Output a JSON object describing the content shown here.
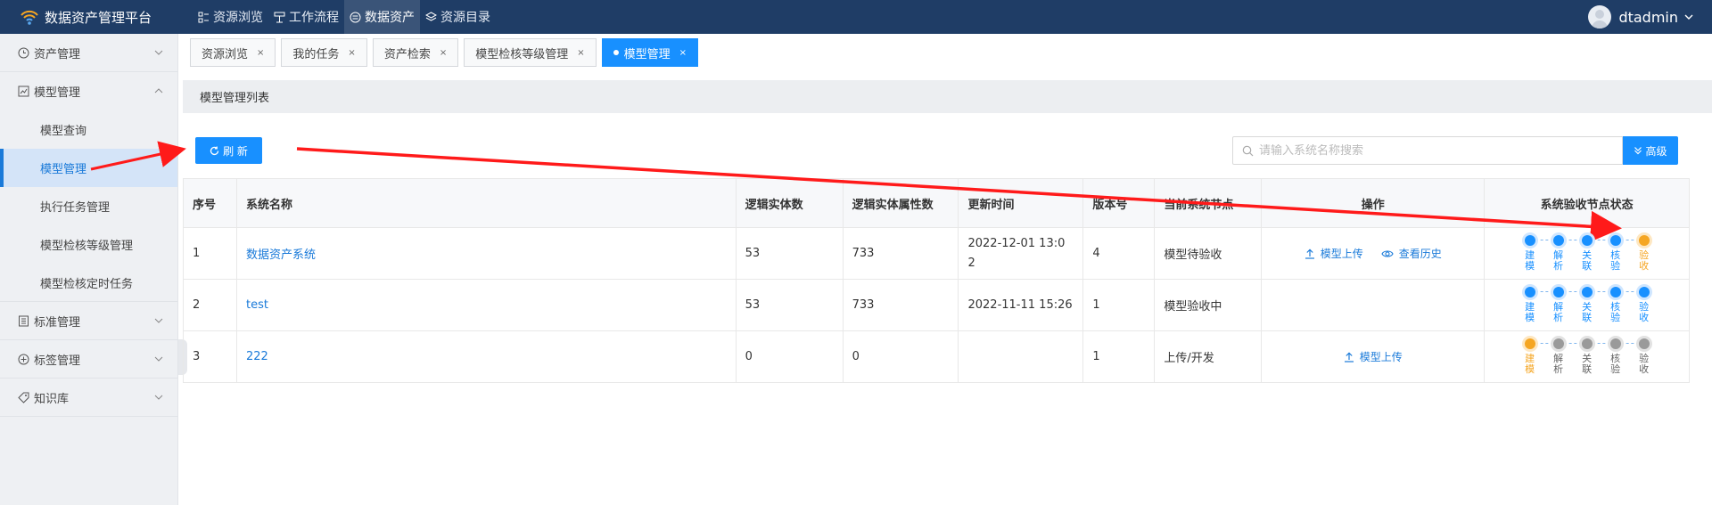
{
  "app": {
    "title": "数据资产管理平台"
  },
  "topnav": [
    {
      "label": "资源浏览",
      "icon": "grid-icon",
      "active": false
    },
    {
      "label": "工作流程",
      "icon": "flow-icon",
      "active": false
    },
    {
      "label": "数据资产",
      "icon": "database-icon",
      "active": true
    },
    {
      "label": "资源目录",
      "icon": "layers-icon",
      "active": false
    }
  ],
  "user": {
    "name": "dtadmin"
  },
  "sidebar": {
    "groups": [
      {
        "label": "资产管理",
        "icon": "clock-icon",
        "expanded": false
      },
      {
        "label": "模型管理",
        "icon": "chart-icon",
        "expanded": true,
        "items": [
          {
            "label": "模型查询",
            "active": false
          },
          {
            "label": "模型管理",
            "active": true
          },
          {
            "label": "执行任务管理",
            "active": false
          },
          {
            "label": "模型检核等级管理",
            "active": false
          },
          {
            "label": "模型检核定时任务",
            "active": false
          }
        ]
      },
      {
        "label": "标准管理",
        "icon": "document-icon",
        "expanded": false
      },
      {
        "label": "标签管理",
        "icon": "plus-circle-icon",
        "expanded": false
      },
      {
        "label": "知识库",
        "icon": "tag-icon",
        "expanded": false
      }
    ]
  },
  "tabs": [
    {
      "label": "资源浏览",
      "active": false
    },
    {
      "label": "我的任务",
      "active": false
    },
    {
      "label": "资产检索",
      "active": false
    },
    {
      "label": "模型检核等级管理",
      "active": false
    },
    {
      "label": "模型管理",
      "active": true
    }
  ],
  "tab_close": "×",
  "panel": {
    "title": "模型管理列表"
  },
  "toolbar": {
    "refresh_label": "刷 新",
    "search_placeholder": "请输入系统名称搜索",
    "advanced_label": "高级"
  },
  "table": {
    "columns": [
      "序号",
      "系统名称",
      "逻辑实体数",
      "逻辑实体属性数",
      "更新时间",
      "版本号",
      "当前系统节点",
      "操作",
      "系统验收节点状态"
    ],
    "rows": [
      {
        "index": "1",
        "name": "数据资产系统",
        "entities": "53",
        "attributes": "733",
        "updated_line1": "2022-12-01 13:0",
        "updated_line2": "2",
        "version": "4",
        "node": "模型待验收",
        "actions": [
          "模型上传",
          "查看历史"
        ],
        "stages": [
          "done",
          "done",
          "done",
          "done",
          "current"
        ]
      },
      {
        "index": "2",
        "name": "test",
        "entities": "53",
        "attributes": "733",
        "updated_line1": "2022-11-11 15:26",
        "updated_line2": "",
        "version": "1",
        "node": "模型验收中",
        "actions": [],
        "stages": [
          "done",
          "done",
          "done",
          "done",
          "done"
        ]
      },
      {
        "index": "3",
        "name": "222",
        "entities": "0",
        "attributes": "0",
        "updated_line1": "",
        "updated_line2": "",
        "version": "1",
        "node": "上传/开发",
        "actions": [
          "模型上传"
        ],
        "stages": [
          "current",
          "pending",
          "pending",
          "pending",
          "pending"
        ]
      }
    ],
    "stage_labels": [
      "建模",
      "解析",
      "关联",
      "核验",
      "验收"
    ]
  },
  "colors": {
    "topbar": "#1f3d66",
    "accent": "#1890ff",
    "current_stage": "#f5a623",
    "pending_stage": "#9a9a9a",
    "annotation_arrow": "#ff1a1a"
  }
}
